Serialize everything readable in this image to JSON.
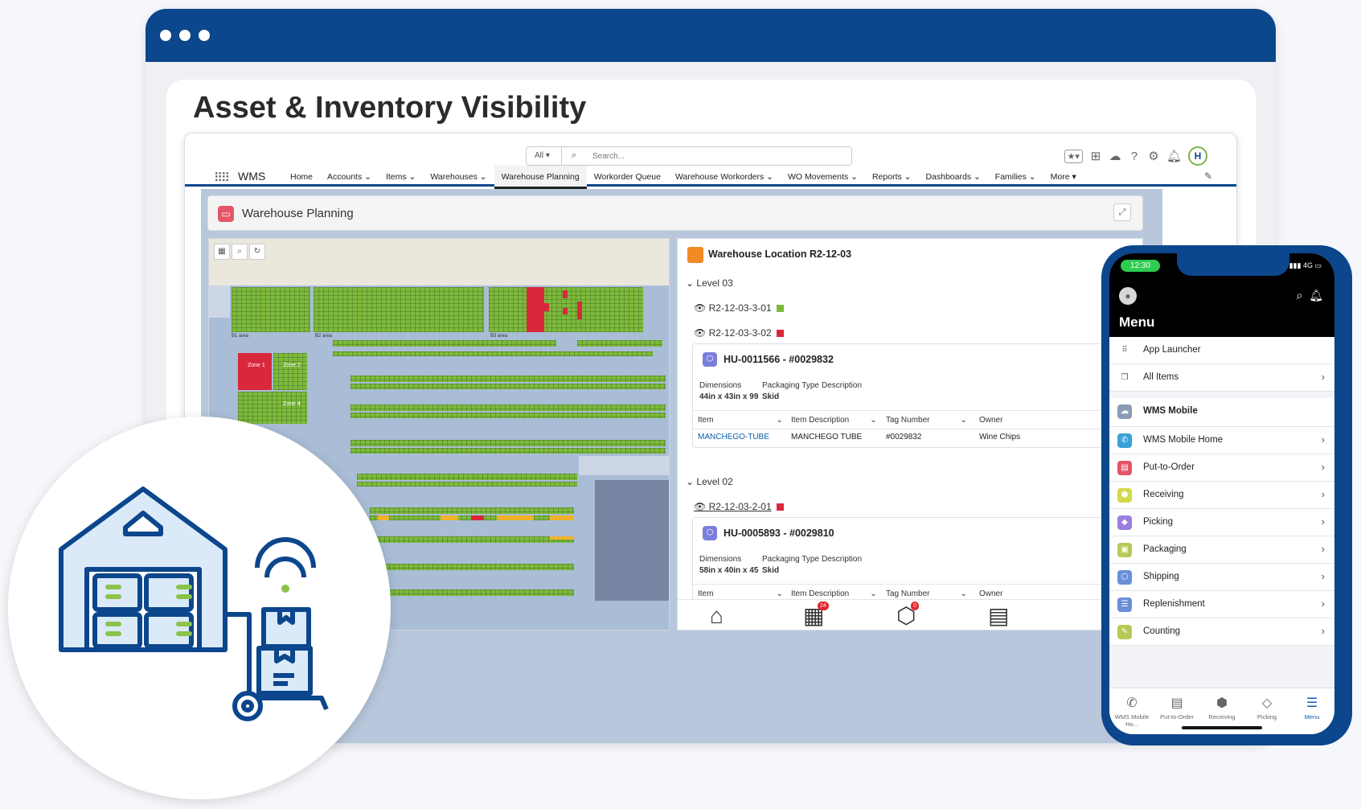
{
  "headline": "Asset & Inventory Visibility",
  "search": {
    "scope": "All",
    "placeholder": "Search..."
  },
  "nav": {
    "app_name": "WMS",
    "items": [
      "Home",
      "Accounts",
      "Items",
      "Warehouses",
      "Warehouse Planning",
      "Workorder Queue",
      "Warehouse Workorders",
      "WO Movements",
      "Reports",
      "Dashboards",
      "Families",
      "More"
    ]
  },
  "page": {
    "title": "Warehouse Planning"
  },
  "map": {
    "area_labels": [
      "B1 area",
      "B2 area",
      "B3 area"
    ],
    "zone_labels": [
      "Zone 1",
      "Zone 2",
      "Zone 4"
    ]
  },
  "detail": {
    "title": "Warehouse Location R2-12-03",
    "levels": [
      {
        "label": "Level 03",
        "locations": [
          {
            "code": "R2-12-03-3-01",
            "status_color": "#7cba3c"
          },
          {
            "code": "R2-12-03-3-02",
            "status_color": "#d9283c"
          }
        ],
        "hu": {
          "title": "HU-0011566 - #0029832",
          "dimensions_label": "Dimensions",
          "dimensions": "44in x 43in x 99",
          "packaging_label": "Packaging Type",
          "packaging": "Skid",
          "description_label": "Description",
          "columns": [
            "Item",
            "Item Description",
            "Tag Number",
            "Owner"
          ],
          "row": {
            "item": "MANCHEGO-TUBE",
            "description": "MANCHEGO TUBE",
            "tag": "#0029832",
            "owner": "Wine Chips"
          }
        }
      },
      {
        "label": "Level 02",
        "locations": [
          {
            "code": "R2-12-03-2-01",
            "status_color": "#d9283c"
          }
        ],
        "hu": {
          "title": "HU-0005893 - #0029810",
          "dimensions_label": "Dimensions",
          "dimensions": "58in x 40in x 45",
          "packaging_label": "Packaging Type",
          "packaging": "Skid",
          "description_label": "Description",
          "columns": [
            "Item",
            "Item Description",
            "Tag Number",
            "Owner"
          ]
        }
      }
    ],
    "dock_badges": [
      "24",
      "0"
    ]
  },
  "phone": {
    "time": "12:30",
    "network": "4G",
    "menu_title": "Menu",
    "top_items": [
      "App Launcher",
      "All Items"
    ],
    "section": "WMS Mobile",
    "items": [
      {
        "label": "WMS Mobile Home",
        "color": "#3aa0d8"
      },
      {
        "label": "Put-to-Order",
        "color": "#e3566a"
      },
      {
        "label": "Receiving",
        "color": "#d4d94a"
      },
      {
        "label": "Picking",
        "color": "#9a7ee0"
      },
      {
        "label": "Packaging",
        "color": "#b7c957"
      },
      {
        "label": "Shipping",
        "color": "#6a8fd8"
      },
      {
        "label": "Replenishment",
        "color": "#6a8fd8"
      },
      {
        "label": "Counting",
        "color": "#b7c957"
      }
    ],
    "tabs": [
      "WMS Mobile Ho...",
      "Put-to-Order",
      "Receiving",
      "Picking",
      "Menu"
    ]
  }
}
